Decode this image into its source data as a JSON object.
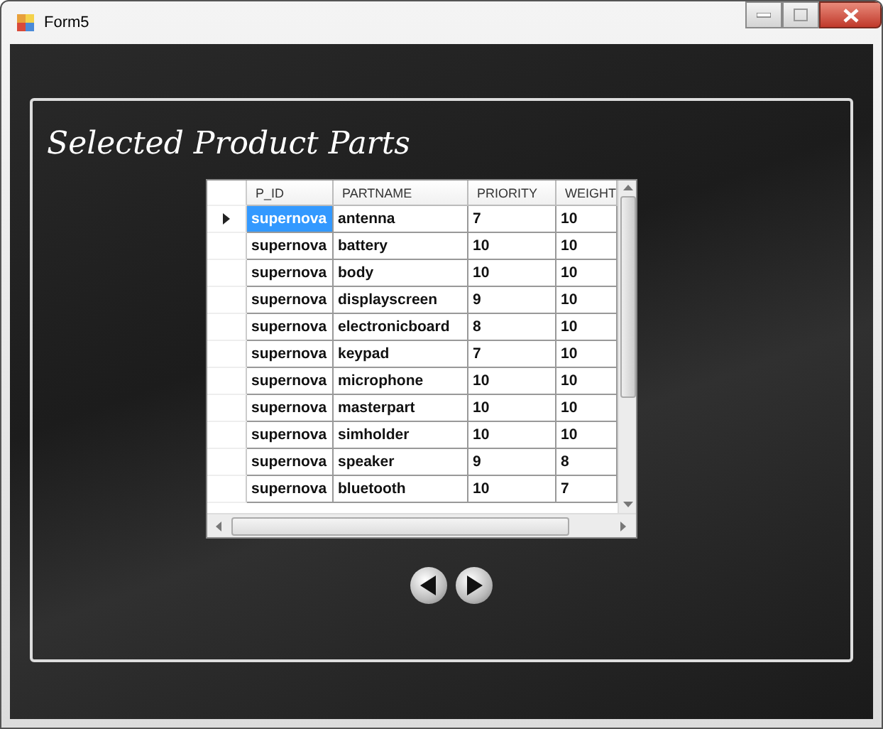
{
  "window": {
    "title": "Form5"
  },
  "heading": "Selected Product Parts",
  "table": {
    "columns": [
      "P_ID",
      "PARTNAME",
      "PRIORITY",
      "WEIGHT"
    ],
    "rows": [
      {
        "cells": [
          "supernova",
          "antenna",
          "7",
          "10"
        ],
        "selected": true
      },
      {
        "cells": [
          "supernova",
          "battery",
          "10",
          "10"
        ],
        "selected": false
      },
      {
        "cells": [
          "supernova",
          "body",
          "10",
          "10"
        ],
        "selected": false
      },
      {
        "cells": [
          "supernova",
          "displayscreen",
          "9",
          "10"
        ],
        "selected": false
      },
      {
        "cells": [
          "supernova",
          "electronicboard",
          "8",
          "10"
        ],
        "selected": false
      },
      {
        "cells": [
          "supernova",
          "keypad",
          "7",
          "10"
        ],
        "selected": false
      },
      {
        "cells": [
          "supernova",
          "microphone",
          "10",
          "10"
        ],
        "selected": false
      },
      {
        "cells": [
          "supernova",
          "masterpart",
          "10",
          "10"
        ],
        "selected": false
      },
      {
        "cells": [
          "supernova",
          "simholder",
          "10",
          "10"
        ],
        "selected": false
      },
      {
        "cells": [
          "supernova",
          "speaker",
          "9",
          "8"
        ],
        "selected": false
      },
      {
        "cells": [
          "supernova",
          "bluetooth",
          "10",
          "7"
        ],
        "selected": false
      }
    ]
  }
}
